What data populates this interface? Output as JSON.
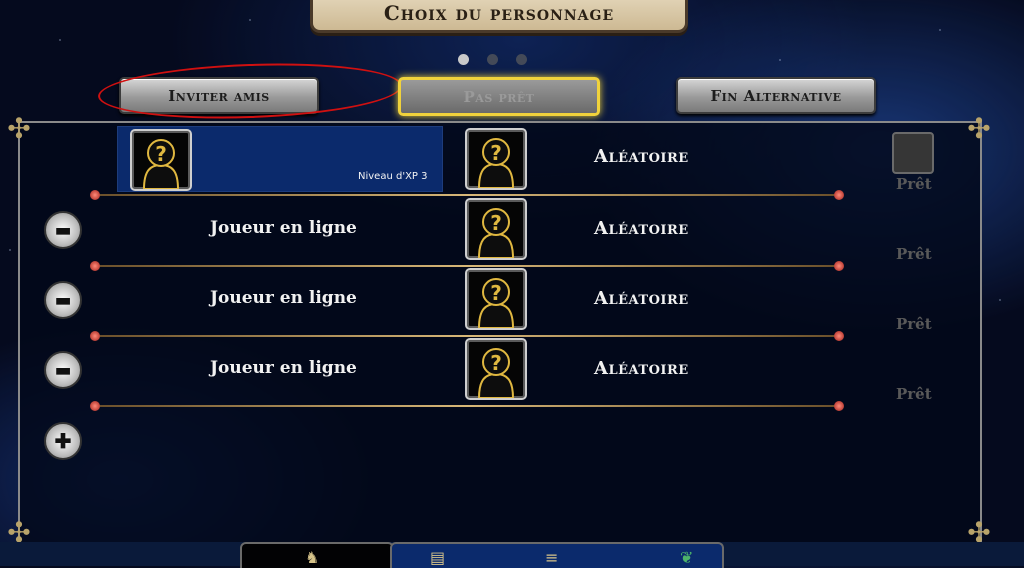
{
  "title": "Choix du personnage",
  "pager": {
    "count": 3,
    "active": 0
  },
  "buttons": {
    "invite": "Inviter amis",
    "ready": "Pas prêt",
    "alternative": "Fin Alternative"
  },
  "rows": [
    {
      "type": "local",
      "xp": "Niveau d'XP 3",
      "character": "Aléatoire",
      "ready_label": "Prêt"
    },
    {
      "type": "online",
      "name": "Joueur en ligne",
      "character": "Aléatoire",
      "ready_label": "Prêt"
    },
    {
      "type": "online",
      "name": "Joueur en ligne",
      "character": "Aléatoire",
      "ready_label": "Prêt"
    },
    {
      "type": "online",
      "name": "Joueur en ligne",
      "character": "Aléatoire",
      "ready_label": "Prêt"
    }
  ],
  "colors": {
    "accent": "#f0d23c",
    "annotation": "#d01010",
    "panel": "#0b2a6c"
  },
  "icons": {
    "kick": "kick-player-icon",
    "add": "add-player-icon",
    "portrait": "unknown-character-icon"
  }
}
